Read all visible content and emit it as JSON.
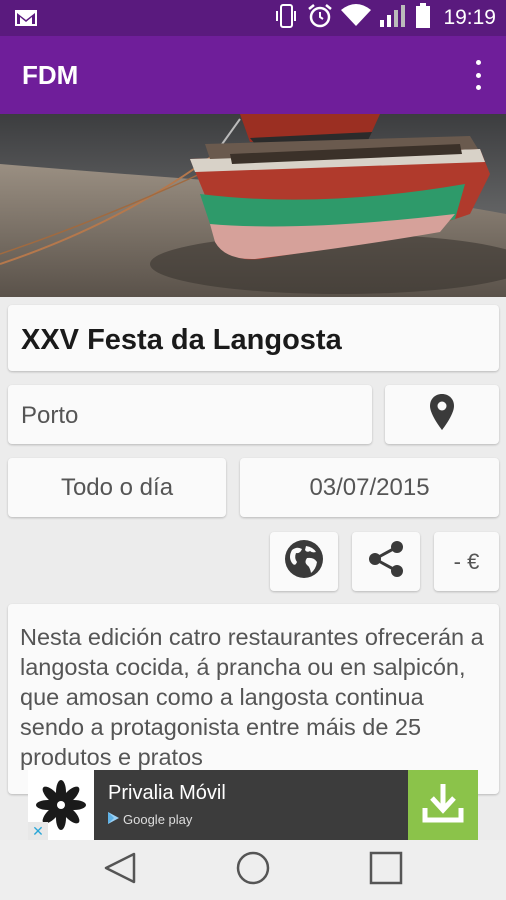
{
  "status_bar": {
    "time": "19:19",
    "icons": [
      "gmail-icon",
      "vibrate-icon",
      "alarm-icon",
      "wifi-icon",
      "signal-icon",
      "battery-icon"
    ]
  },
  "app_bar": {
    "title": "FDM",
    "menu_icon": "overflow-menu-icon"
  },
  "hero": {
    "description": "boat-photo"
  },
  "event": {
    "title": "XXV Festa da Langosta",
    "location": "Porto",
    "time": "Todo o día",
    "date": "03/07/2015",
    "price": "- €",
    "description": "Nesta edición catro restaurantes ofrecerán a langosta cocida, á prancha ou en salpicón, que amosan como a langosta continua sendo a protagonista entre máis de 25 produtos e pratos"
  },
  "ad": {
    "title": "Privalia Móvil",
    "store": "Google play",
    "close_label": "✕"
  },
  "colors": {
    "status_bar": "#5a1a7e",
    "app_bar": "#6f1e9a",
    "download_green": "#8bc34a"
  }
}
